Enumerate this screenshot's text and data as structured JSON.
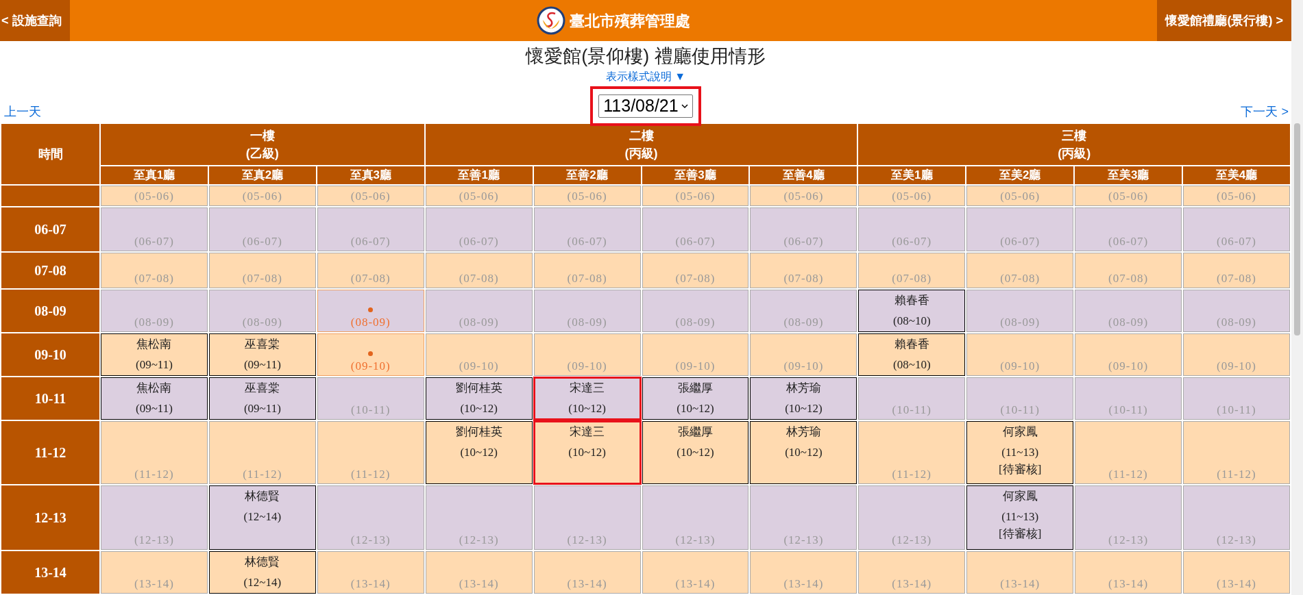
{
  "header": {
    "back_link": "< 設施查詢",
    "site_title": "臺北市殯葬管理處",
    "forward_link": "懷愛館禮廳(景行樓) >"
  },
  "page_title": "懷愛館(景仰樓) 禮廳使用情形",
  "legend_link": "表示樣式說明 ▼",
  "date_select": {
    "value": "113/08/21",
    "highlighted": true
  },
  "prev_day": "上一天",
  "next_day": "下一天 >",
  "table": {
    "time_header": "時間",
    "floors": [
      {
        "name": "一樓",
        "grade": "(乙級)",
        "halls": [
          "至真1廳",
          "至真2廳",
          "至真3廳"
        ]
      },
      {
        "name": "二樓",
        "grade": "(丙級)",
        "halls": [
          "至善1廳",
          "至善2廳",
          "至善3廳",
          "至善4廳"
        ]
      },
      {
        "name": "三樓",
        "grade": "(丙級)",
        "halls": [
          "至美1廳",
          "至美2廳",
          "至美3廳",
          "至美4廳"
        ]
      }
    ],
    "rows": [
      {
        "cells": [
          {
            "kind": "free",
            "slot": "(05-06)"
          },
          {
            "kind": "free",
            "slot": "(05-06)"
          },
          {
            "kind": "free",
            "slot": "(05-06)"
          },
          {
            "kind": "free",
            "slot": "(05-06)"
          },
          {
            "kind": "free",
            "slot": "(05-06)"
          },
          {
            "kind": "free",
            "slot": "(05-06)"
          },
          {
            "kind": "free",
            "slot": "(05-06)"
          },
          {
            "kind": "free",
            "slot": "(05-06)"
          },
          {
            "kind": "free",
            "slot": "(05-06)"
          },
          {
            "kind": "free",
            "slot": "(05-06)"
          },
          {
            "kind": "free",
            "slot": "(05-06)"
          }
        ]
      },
      {
        "time": "06-07",
        "cells": [
          {
            "kind": "free",
            "slot": "(06-07)"
          },
          {
            "kind": "free",
            "slot": "(06-07)"
          },
          {
            "kind": "free",
            "slot": "(06-07)"
          },
          {
            "kind": "free",
            "slot": "(06-07)"
          },
          {
            "kind": "free",
            "slot": "(06-07)"
          },
          {
            "kind": "free",
            "slot": "(06-07)"
          },
          {
            "kind": "free",
            "slot": "(06-07)"
          },
          {
            "kind": "free",
            "slot": "(06-07)"
          },
          {
            "kind": "free",
            "slot": "(06-07)"
          },
          {
            "kind": "free",
            "slot": "(06-07)"
          },
          {
            "kind": "free",
            "slot": "(06-07)"
          }
        ]
      },
      {
        "time": "07-08",
        "cells": [
          {
            "kind": "free",
            "slot": "(07-08)"
          },
          {
            "kind": "free",
            "slot": "(07-08)"
          },
          {
            "kind": "free",
            "slot": "(07-08)"
          },
          {
            "kind": "free",
            "slot": "(07-08)"
          },
          {
            "kind": "free",
            "slot": "(07-08)"
          },
          {
            "kind": "free",
            "slot": "(07-08)"
          },
          {
            "kind": "free",
            "slot": "(07-08)"
          },
          {
            "kind": "free",
            "slot": "(07-08)"
          },
          {
            "kind": "free",
            "slot": "(07-08)"
          },
          {
            "kind": "free",
            "slot": "(07-08)"
          },
          {
            "kind": "free",
            "slot": "(07-08)"
          }
        ]
      },
      {
        "time": "08-09",
        "cells": [
          {
            "kind": "free",
            "slot": "(08-09)"
          },
          {
            "kind": "free",
            "slot": "(08-09)"
          },
          {
            "kind": "marked",
            "slot": "(08-09)"
          },
          {
            "kind": "free",
            "slot": "(08-09)"
          },
          {
            "kind": "free",
            "slot": "(08-09)"
          },
          {
            "kind": "free",
            "slot": "(08-09)"
          },
          {
            "kind": "free",
            "slot": "(08-09)"
          },
          {
            "kind": "booked",
            "name": "賴春香",
            "range": "(08~10)"
          },
          {
            "kind": "free",
            "slot": "(08-09)"
          },
          {
            "kind": "free",
            "slot": "(08-09)"
          },
          {
            "kind": "free",
            "slot": "(08-09)"
          }
        ]
      },
      {
        "time": "09-10",
        "cells": [
          {
            "kind": "booked",
            "name": "焦松南",
            "range": "(09~11)"
          },
          {
            "kind": "booked",
            "name": "巫喜棠",
            "range": "(09~11)"
          },
          {
            "kind": "marked",
            "slot": "(09-10)"
          },
          {
            "kind": "free",
            "slot": "(09-10)"
          },
          {
            "kind": "free",
            "slot": "(09-10)"
          },
          {
            "kind": "free",
            "slot": "(09-10)"
          },
          {
            "kind": "free",
            "slot": "(09-10)"
          },
          {
            "kind": "booked",
            "name": "賴春香",
            "range": "(08~10)"
          },
          {
            "kind": "free",
            "slot": "(09-10)"
          },
          {
            "kind": "free",
            "slot": "(09-10)"
          },
          {
            "kind": "free",
            "slot": "(09-10)"
          }
        ]
      },
      {
        "time": "10-11",
        "cells": [
          {
            "kind": "booked",
            "name": "焦松南",
            "range": "(09~11)"
          },
          {
            "kind": "booked",
            "name": "巫喜棠",
            "range": "(09~11)"
          },
          {
            "kind": "free",
            "slot": "(10-11)"
          },
          {
            "kind": "booked",
            "name": "劉何桂英",
            "range": "(10~12)"
          },
          {
            "kind": "booked",
            "name": "宋達三",
            "range": "(10~12)",
            "highlighted": true
          },
          {
            "kind": "booked",
            "name": "張繼厚",
            "range": "(10~12)"
          },
          {
            "kind": "booked",
            "name": "林芳瑜",
            "range": "(10~12)"
          },
          {
            "kind": "free",
            "slot": "(10-11)"
          },
          {
            "kind": "free",
            "slot": "(10-11)"
          },
          {
            "kind": "free",
            "slot": "(10-11)"
          },
          {
            "kind": "free",
            "slot": "(10-11)"
          }
        ]
      },
      {
        "time": "11-12",
        "cells": [
          {
            "kind": "free",
            "slot": "(11-12)"
          },
          {
            "kind": "free",
            "slot": "(11-12)"
          },
          {
            "kind": "free",
            "slot": "(11-12)"
          },
          {
            "kind": "booked",
            "name": "劉何桂英",
            "range": "(10~12)"
          },
          {
            "kind": "booked",
            "name": "宋達三",
            "range": "(10~12)",
            "highlighted": true
          },
          {
            "kind": "booked",
            "name": "張繼厚",
            "range": "(10~12)"
          },
          {
            "kind": "booked",
            "name": "林芳瑜",
            "range": "(10~12)"
          },
          {
            "kind": "free",
            "slot": "(11-12)"
          },
          {
            "kind": "booked",
            "name": "何家鳳",
            "range": "(11~13)",
            "note": "[待審核]"
          },
          {
            "kind": "free",
            "slot": "(11-12)"
          },
          {
            "kind": "free",
            "slot": "(11-12)"
          }
        ]
      },
      {
        "time": "12-13",
        "cells": [
          {
            "kind": "free",
            "slot": "(12-13)"
          },
          {
            "kind": "booked",
            "name": "林德賢",
            "range": "(12~14)"
          },
          {
            "kind": "free",
            "slot": "(12-13)"
          },
          {
            "kind": "free",
            "slot": "(12-13)"
          },
          {
            "kind": "free",
            "slot": "(12-13)"
          },
          {
            "kind": "free",
            "slot": "(12-13)"
          },
          {
            "kind": "free",
            "slot": "(12-13)"
          },
          {
            "kind": "free",
            "slot": "(12-13)"
          },
          {
            "kind": "booked",
            "name": "何家鳳",
            "range": "(11~13)",
            "note": "[待審核]"
          },
          {
            "kind": "free",
            "slot": "(12-13)"
          },
          {
            "kind": "free",
            "slot": "(12-13)"
          }
        ]
      },
      {
        "time": "13-14",
        "cells": [
          {
            "kind": "free",
            "slot": "(13-14)"
          },
          {
            "kind": "booked",
            "name": "林德賢",
            "range": "(12~14)"
          },
          {
            "kind": "free",
            "slot": "(13-14)"
          },
          {
            "kind": "free",
            "slot": "(13-14)"
          },
          {
            "kind": "free",
            "slot": "(13-14)"
          },
          {
            "kind": "free",
            "slot": "(13-14)"
          },
          {
            "kind": "free",
            "slot": "(13-14)"
          },
          {
            "kind": "free",
            "slot": "(13-14)"
          },
          {
            "kind": "free",
            "slot": "(13-14)"
          },
          {
            "kind": "free",
            "slot": "(13-14)"
          },
          {
            "kind": "free",
            "slot": "(13-14)"
          }
        ]
      }
    ]
  }
}
